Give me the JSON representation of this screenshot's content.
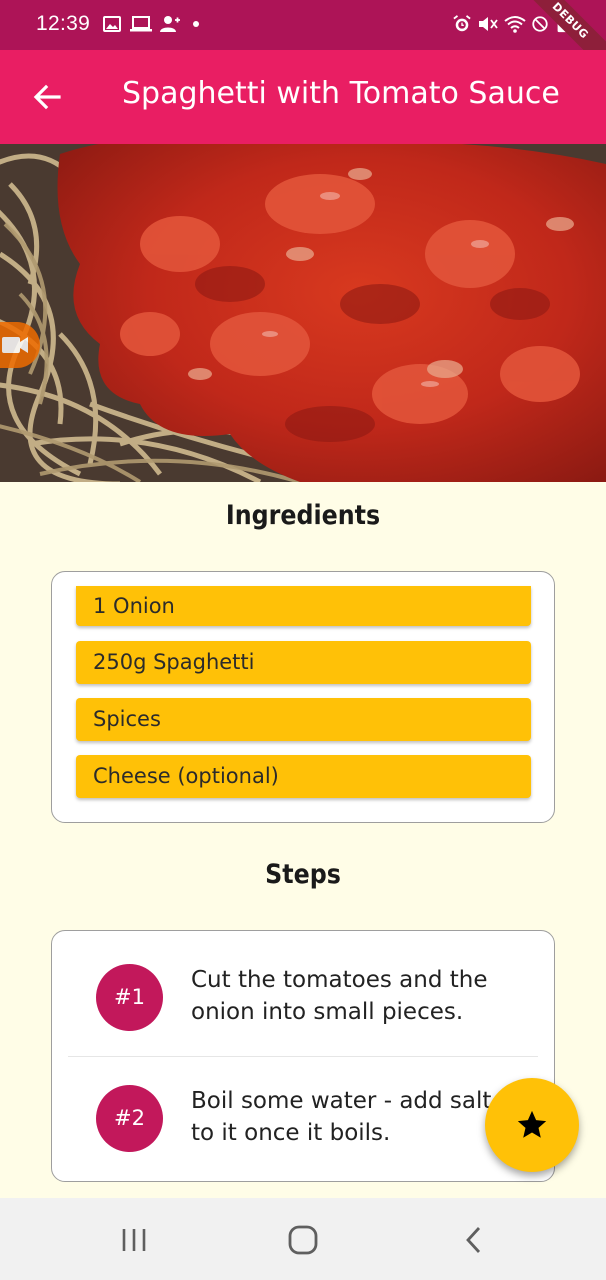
{
  "status_bar": {
    "time": "12:39",
    "icons": [
      "image-icon",
      "laptop-icon",
      "person-add-icon",
      "dot",
      "alarm-icon",
      "mute-icon",
      "wifi-icon",
      "block-icon",
      "battery-icon"
    ]
  },
  "debug_banner": "DEBUG",
  "app_bar": {
    "back_icon": "arrow-back-icon",
    "title": "Spaghetti with Tomato Sauce"
  },
  "ingredients": {
    "title": "Ingredients",
    "items": [
      "1 Onion",
      "250g Spaghetti",
      "Spices",
      "Cheese (optional)"
    ]
  },
  "steps": {
    "title": "Steps",
    "items": [
      {
        "number": "#1",
        "line1": "Cut the tomatoes and the",
        "line2": "onion into small pieces."
      },
      {
        "number": "#2",
        "line1": "Boil some water - add salt",
        "line2": "to it once it boils."
      }
    ]
  },
  "fab": {
    "icon": "star-icon"
  },
  "nav_bar": {
    "icons": [
      "recent-apps-icon",
      "home-icon",
      "back-nav-icon"
    ]
  },
  "colors": {
    "status_bar": "#ad1457",
    "app_bar": "#e91e63",
    "background": "#fffde7",
    "ingredient_chip": "#ffc107",
    "step_badge": "#c2185b",
    "fab": "#ffc107"
  }
}
